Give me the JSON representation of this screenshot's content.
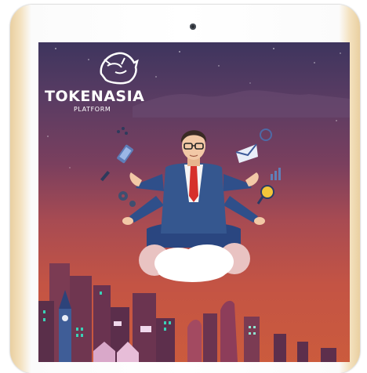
{
  "brand": {
    "name": "TOKENASIA",
    "subtitle": "PLATFORM",
    "logo_icon": "lion-head-icon"
  },
  "colors": {
    "sky_top": "#3e355e",
    "sky_bottom": "#cb5b3d",
    "suit": "#2f4f8a",
    "tie": "#d6302b"
  },
  "illustration": {
    "icons": [
      "envelope-icon",
      "smartphone-icon",
      "magnifier-icon",
      "gear-icon",
      "bar-chart-icon",
      "pencil-icon",
      "chat-icon"
    ]
  }
}
